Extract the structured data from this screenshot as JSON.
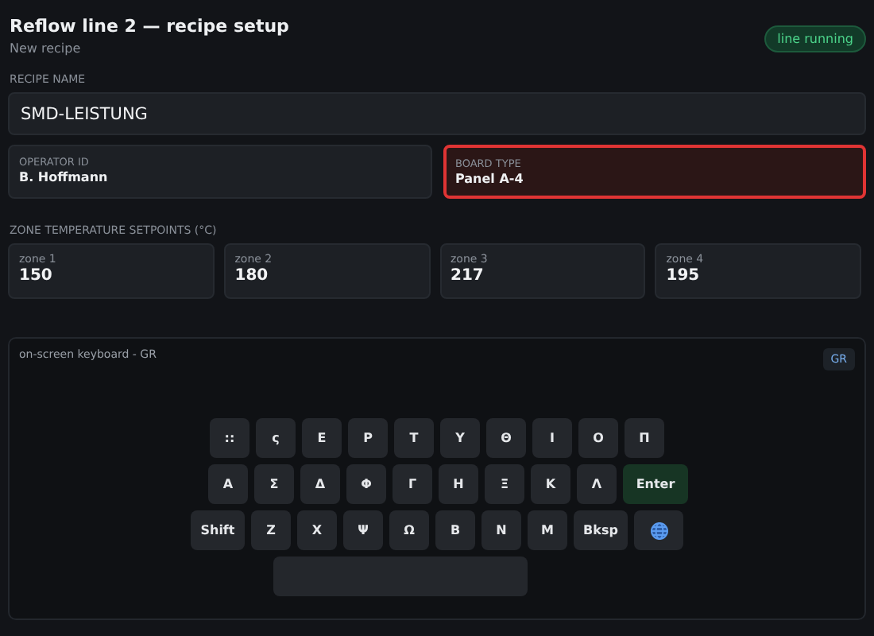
{
  "header": {
    "title": "Reflow line 2 — recipe setup",
    "subtitle": "New recipe",
    "status": {
      "label": "line running",
      "running": true
    }
  },
  "recipe_name": {
    "label": "RECIPE NAME",
    "value": "SMD-LEISTUNG"
  },
  "fields": [
    {
      "label": "OPERATOR ID",
      "value": "B. Hoffmann",
      "invalid": false
    },
    {
      "label": "BOARD TYPE",
      "value": "Panel A-4",
      "invalid": true
    }
  ],
  "zones": {
    "label": "ZONE TEMPERATURE SETPOINTS (°C)",
    "items": [
      {
        "name": "zone 1",
        "value": "150"
      },
      {
        "name": "zone 2",
        "value": "180"
      },
      {
        "name": "zone 3",
        "value": "217"
      },
      {
        "name": "zone 4",
        "value": "195"
      }
    ]
  },
  "keyboard": {
    "title": "on-screen keyboard - GR",
    "layout": "GR",
    "rows": [
      [
        {
          "kind": "char",
          "label": "::"
        },
        {
          "kind": "char",
          "label": "ς"
        },
        {
          "kind": "char",
          "label": "Ε"
        },
        {
          "kind": "char",
          "label": "Ρ"
        },
        {
          "kind": "char",
          "label": "Τ"
        },
        {
          "kind": "char",
          "label": "Υ"
        },
        {
          "kind": "char",
          "label": "Θ"
        },
        {
          "kind": "char",
          "label": "Ι"
        },
        {
          "kind": "char",
          "label": "Ο"
        },
        {
          "kind": "char",
          "label": "Π"
        }
      ],
      [
        {
          "kind": "char",
          "label": "Α"
        },
        {
          "kind": "char",
          "label": "Σ"
        },
        {
          "kind": "char",
          "label": "Δ"
        },
        {
          "kind": "char",
          "label": "Φ"
        },
        {
          "kind": "char",
          "label": "Γ"
        },
        {
          "kind": "char",
          "label": "Η"
        },
        {
          "kind": "char",
          "label": "Ξ"
        },
        {
          "kind": "char",
          "label": "Κ"
        },
        {
          "kind": "char",
          "label": "Λ"
        },
        {
          "kind": "enter",
          "label": "Enter"
        }
      ],
      [
        {
          "kind": "action",
          "label": "Shift"
        },
        {
          "kind": "char",
          "label": "Ζ"
        },
        {
          "kind": "char",
          "label": "Χ"
        },
        {
          "kind": "char",
          "label": "Ψ"
        },
        {
          "kind": "char",
          "label": "Ω"
        },
        {
          "kind": "char",
          "label": "Β"
        },
        {
          "kind": "char",
          "label": "Ν"
        },
        {
          "kind": "char",
          "label": "Μ"
        },
        {
          "kind": "action",
          "label": "Bksp"
        },
        {
          "kind": "globe"
        }
      ],
      [
        {
          "kind": "space"
        }
      ]
    ]
  }
}
